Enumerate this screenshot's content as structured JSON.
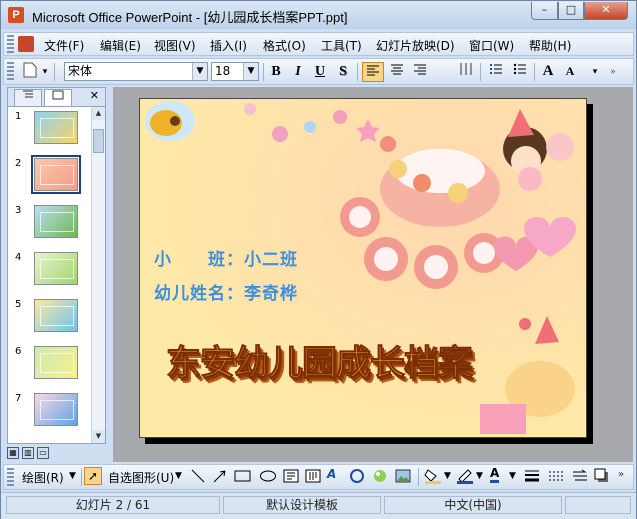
{
  "window": {
    "title": "Microsoft Office PowerPoint - [幼儿园成长档案PPT.ppt]",
    "controls": {
      "minimize": "–",
      "maximize": "□",
      "close": "✕"
    }
  },
  "menu": [
    "文件(F)",
    "编辑(E)",
    "视图(V)",
    "插入(I)",
    "格式(O)",
    "工具(T)",
    "幻灯片放映(D)",
    "窗口(W)",
    "帮助(H)"
  ],
  "toolbar": {
    "font_name": "宋体",
    "font_size": "18",
    "bold": "B",
    "italic": "I",
    "underline": "U",
    "shadow": "S",
    "grow_font": "A",
    "shrink_font": "A"
  },
  "outline_pane": {
    "tab_outline_icon": "outline-icon",
    "tab_slides_icon": "slides-icon",
    "close": "✕",
    "slides": [
      {
        "number": "1",
        "colors": [
          "#8ed3ef",
          "#f7d36b"
        ]
      },
      {
        "number": "2",
        "colors": [
          "#f9c9a8",
          "#f59a8a"
        ]
      },
      {
        "number": "3",
        "colors": [
          "#b9e0f5",
          "#6db64f"
        ]
      },
      {
        "number": "4",
        "colors": [
          "#e9f4d3",
          "#9fd36a"
        ]
      },
      {
        "number": "5",
        "colors": [
          "#fbe9a1",
          "#6ec3ee"
        ]
      },
      {
        "number": "6",
        "colors": [
          "#cfe9b2",
          "#f7ef8b"
        ]
      },
      {
        "number": "7",
        "colors": [
          "#f9d7e6",
          "#5ea3e3"
        ]
      }
    ],
    "selected_slide": "2"
  },
  "slide": {
    "class_line": "小　　班：小二班",
    "name_line": "幼儿姓名：李奇桦",
    "title": "东安幼儿园成长档案",
    "colors": {
      "background": "#ffe7a8",
      "label_text": "#3d8fe0",
      "title_text": "#f29a1a",
      "title_outline": "#8a3a08"
    }
  },
  "drawing_toolbar": {
    "draw": "绘图(R)",
    "autoshapes": "自选图形(U)"
  },
  "status": {
    "slide_counter": "幻灯片 2 / 61",
    "design": "默认设计模板",
    "language": "中文(中国)"
  },
  "colors": {
    "accent": "#f7c46a",
    "frame": "#cfdff1"
  }
}
